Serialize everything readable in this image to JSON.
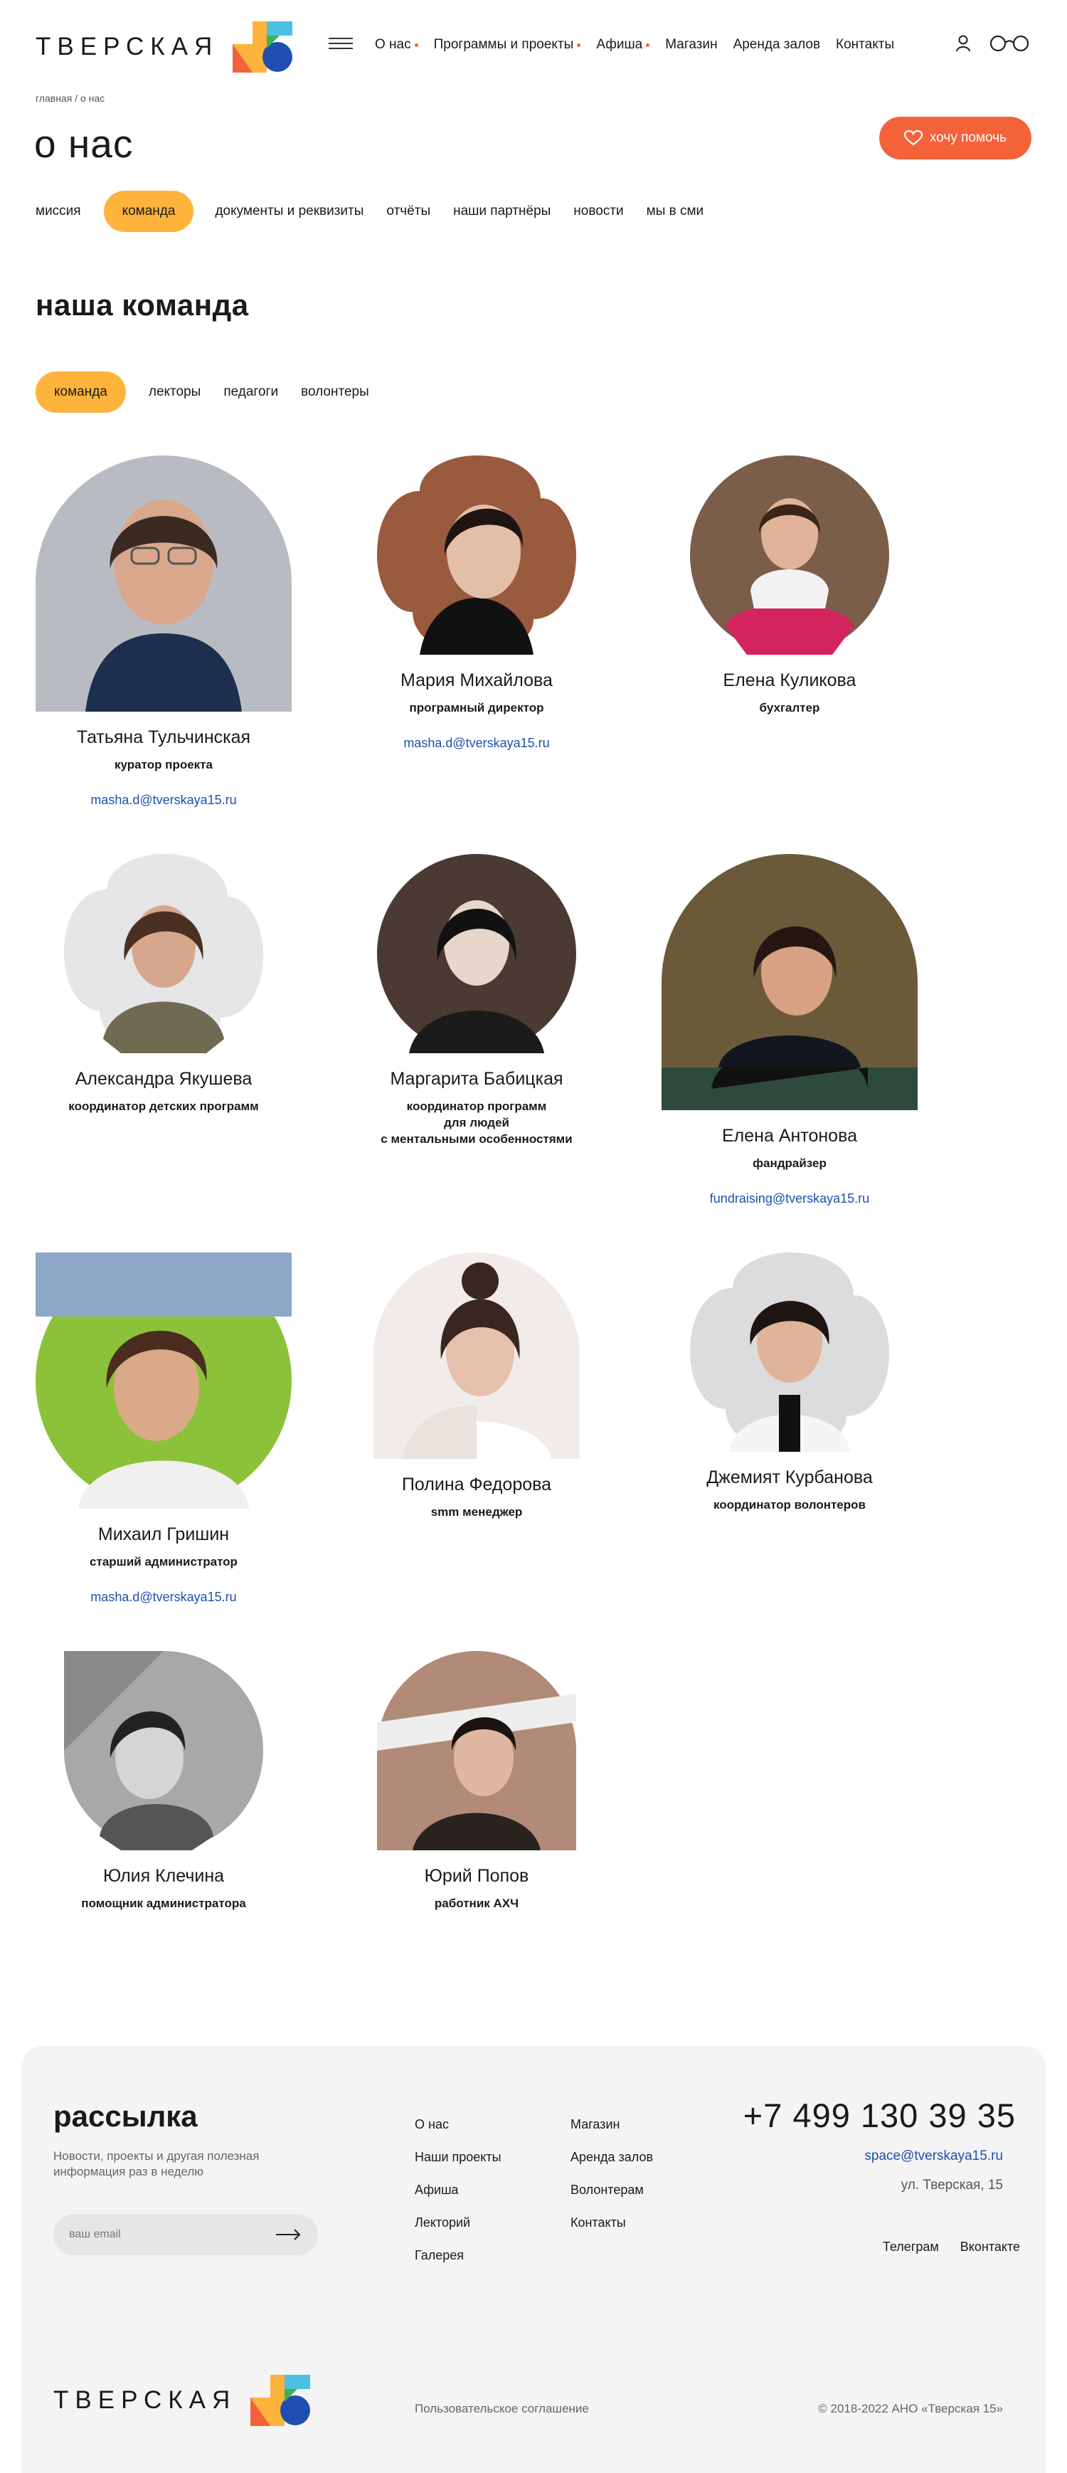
{
  "header": {
    "logo_text": "ТВЕРСКАЯ",
    "nav": [
      {
        "label": "О нас",
        "dot": true
      },
      {
        "label": "Программы и проекты",
        "dot": true
      },
      {
        "label": "Афиша",
        "dot": true
      },
      {
        "label": "Магазин",
        "dot": false
      },
      {
        "label": "Аренда залов",
        "dot": false
      },
      {
        "label": "Контакты",
        "dot": false
      }
    ],
    "icons": [
      "menu-icon",
      "user-icon",
      "glasses-icon"
    ]
  },
  "breadcrumb": "главная / о нас",
  "page_title": "о нас",
  "help_button": "хочу помочь",
  "tabs": [
    "миссия",
    "команда",
    "документы и реквизиты",
    "отчёты",
    "наши партнёры",
    "новости",
    "мы в сми"
  ],
  "active_tab": 1,
  "section_title": "наша команда",
  "subtabs": [
    "команда",
    "лекторы",
    "педагоги",
    "волонтеры"
  ],
  "active_subtab": 0,
  "team": [
    {
      "name": "Татьяна Тульчинская",
      "role": "куратор проекта",
      "email": "masha.d@tverskaya15.ru"
    },
    {
      "name": "Мария Михайлова",
      "role": "програмный директор",
      "email": "masha.d@tverskaya15.ru"
    },
    {
      "name": "Елена Куликова",
      "role": "бухгалтер",
      "email": ""
    },
    {
      "name": "Александра Якушева",
      "role": "координатор детских программ",
      "email": ""
    },
    {
      "name": "Маргарита Бабицкая",
      "role": "координатор программ\nдля людей\nс ментальными особенностями",
      "email": ""
    },
    {
      "name": "Елена Антонова",
      "role": "фандрайзер",
      "email": "fundraising@tverskaya15.ru"
    },
    {
      "name": "Михаил Гришин",
      "role": "старший администратор",
      "email": "masha.d@tverskaya15.ru"
    },
    {
      "name": "Полина Федорова",
      "role": "smm менеджер",
      "email": ""
    },
    {
      "name": "Джемият Курбанова",
      "role": "координатор волонтеров",
      "email": ""
    },
    {
      "name": "Юлия Клечина",
      "role": "помощник администратора",
      "email": ""
    },
    {
      "name": "Юрий Попов",
      "role": "работник АХЧ",
      "email": ""
    }
  ],
  "footer": {
    "title": "рассылка",
    "desc": "Новости, проекты и другая полезная информация раз в неделю",
    "email_placeholder": "ваш email",
    "links_col1": [
      "О нас",
      "Наши проекты",
      "Афиша",
      "Лекторий",
      "Галерея"
    ],
    "links_col2": [
      "Магазин",
      "Аренда залов",
      "Волонтерам",
      "Контакты"
    ],
    "phone": "+7 499 130 39 35",
    "email": "space@tverskaya15.ru",
    "address": "ул. Тверская, 15",
    "social": [
      "Телеграм",
      "Вконтакте"
    ],
    "logo_text": "ТВЕРСКАЯ",
    "agreement": "Пользовательское соглашение",
    "copyright": "© 2018-2022 АНО «Тверская 15»"
  },
  "colors": {
    "accent": "#fdb33c",
    "help": "#f4623a",
    "link": "#1f4fb1",
    "footer_bg": "#f4f4f4"
  }
}
